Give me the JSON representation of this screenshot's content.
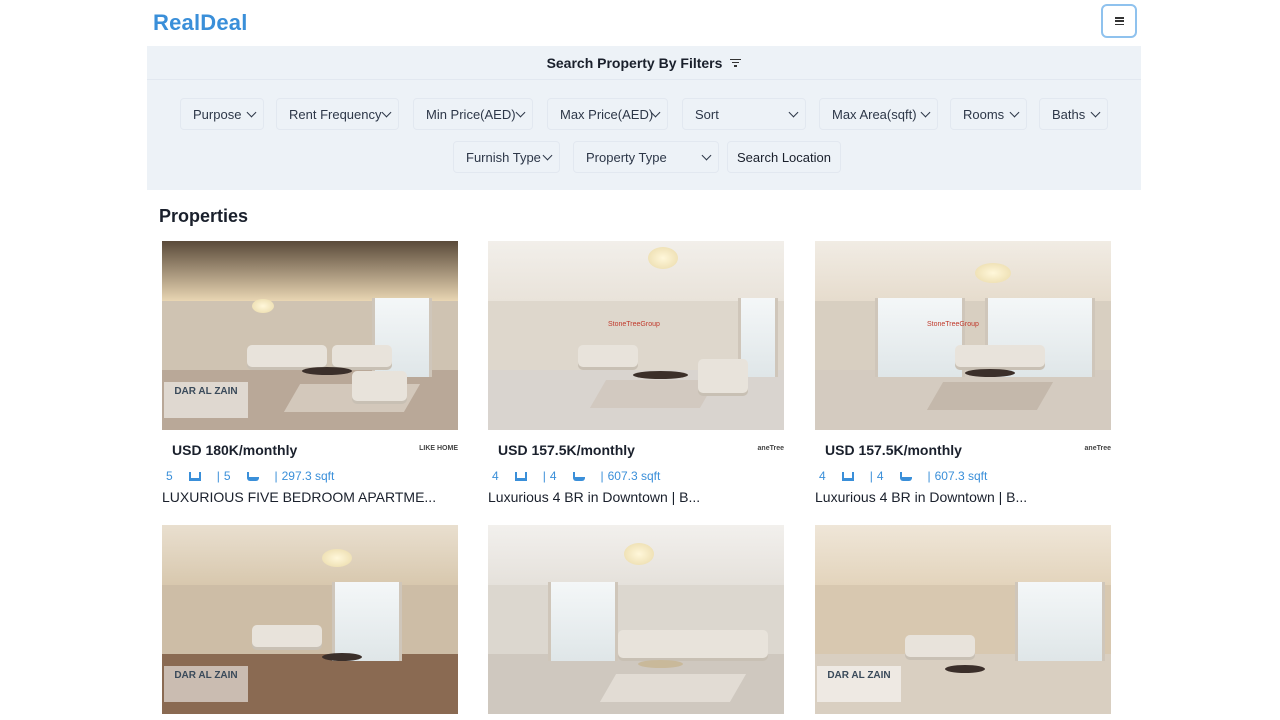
{
  "brand": "RealDeal",
  "filters": {
    "heading": "Search Property By Filters",
    "row1": [
      "Purpose",
      "Rent Frequency",
      "Min Price(AED)",
      "Max Price(AED)",
      "Sort",
      "Max Area(sqft)",
      "Rooms",
      "Baths"
    ],
    "row2": [
      "Furnish Type",
      "Property Type"
    ],
    "search_location": "Search Location"
  },
  "section_title": "Properties",
  "properties": [
    {
      "price": "USD 180K/monthly",
      "rooms": "5",
      "baths": "5",
      "area": "297.3 sqft",
      "title": "LUXURIOUS FIVE BEDROOM APARTME...",
      "agency_logo": "LIKE HOME",
      "watermark": "DAR AL ZAIN"
    },
    {
      "price": "USD 157.5K/monthly",
      "rooms": "4",
      "baths": "4",
      "area": "607.3 sqft",
      "title": "Luxurious 4 BR in Downtown | B...",
      "agency_logo": "aneTree",
      "watermark": "StoneTreeGroup"
    },
    {
      "price": "USD 157.5K/monthly",
      "rooms": "4",
      "baths": "4",
      "area": "607.3 sqft",
      "title": "Luxurious 4 BR in Downtown | B...",
      "agency_logo": "aneTree",
      "watermark": "StoneTreeGroup"
    },
    {
      "watermark": "DAR AL ZAIN"
    },
    {},
    {
      "watermark": "DAR AL ZAIN"
    }
  ],
  "colors": {
    "brand": "#3a8fd9",
    "filter_bg": "#edf2f7"
  }
}
